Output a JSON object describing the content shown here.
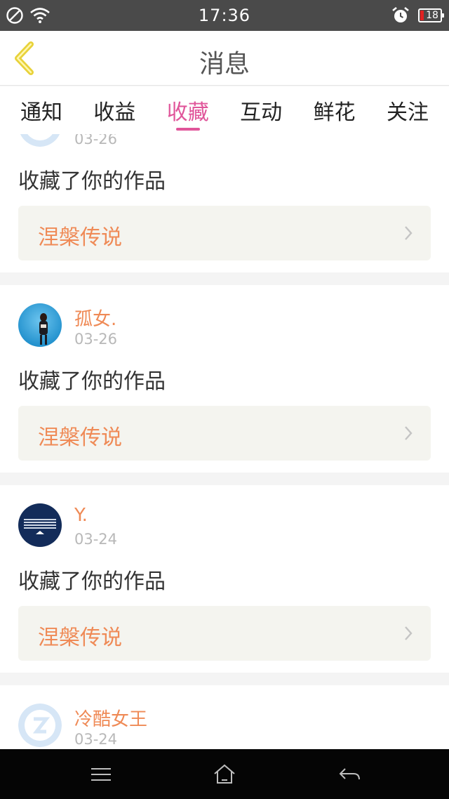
{
  "status_bar": {
    "time": "17:36",
    "battery": "18",
    "icons": [
      "dnd-icon",
      "wifi-icon",
      "alarm-icon",
      "battery-icon"
    ]
  },
  "header": {
    "title": "消息",
    "back_icon": "chevron-left-icon",
    "accent_color": "#e8d23a"
  },
  "tabs": [
    {
      "label": "通知",
      "active": false
    },
    {
      "label": "收益",
      "active": false
    },
    {
      "label": "收藏",
      "active": true
    },
    {
      "label": "互动",
      "active": false
    },
    {
      "label": "鲜花",
      "active": false
    },
    {
      "label": "关注",
      "active": false
    }
  ],
  "colors": {
    "active_tab": "#e0559a",
    "name_orange": "#ef8a56",
    "date_gray": "#b8b8b8",
    "work_box_bg": "#f4f4ef"
  },
  "items": [
    {
      "username": "",
      "date": "03-26",
      "action": "收藏了你的作品",
      "work_title": "涅槃传说",
      "avatar": "default-avatar"
    },
    {
      "username": "孤女.",
      "date": "03-26",
      "action": "收藏了你的作品",
      "work_title": "涅槃传说",
      "avatar": "photo-avatar"
    },
    {
      "username": "Y.",
      "date": "03-24",
      "action": "收藏了你的作品",
      "work_title": "涅槃传说",
      "avatar": "logo-avatar"
    },
    {
      "username": "冷酷女王",
      "date": "03-24",
      "action": "",
      "work_title": "",
      "avatar": "default-avatar"
    }
  ],
  "nav_bar": {
    "icons": [
      "menu-icon",
      "home-icon",
      "back-arrow-icon"
    ]
  }
}
